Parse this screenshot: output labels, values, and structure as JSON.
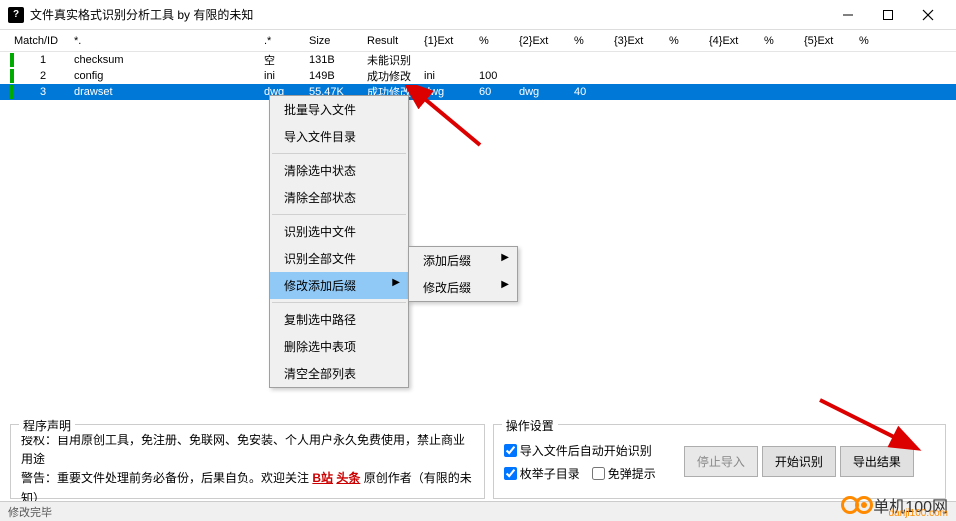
{
  "window": {
    "title": "文件真实格式识别分析工具 by 有限的未知",
    "icon": "?"
  },
  "columns": {
    "match": "Match/ID",
    "star": "*.",
    "dotstar": ".*",
    "size": "Size",
    "result": "Result",
    "e1": "{1}Ext",
    "p1": "%",
    "e2": "{2}Ext",
    "p2": "%",
    "e3": "{3}Ext",
    "p3": "%",
    "e4": "{4}Ext",
    "p4": "%",
    "e5": "{5}Ext",
    "p5": "%"
  },
  "rows": [
    {
      "id": "1",
      "name": "checksum",
      "ds": "空",
      "size": "131B",
      "result": "未能识别",
      "e1": "",
      "p1": "",
      "e2": "",
      "p2": ""
    },
    {
      "id": "2",
      "name": "config",
      "ds": "ini",
      "size": "149B",
      "result": "成功修改",
      "e1": "ini",
      "p1": "100",
      "e2": "",
      "p2": ""
    },
    {
      "id": "3",
      "name": "drawset",
      "ds": "dwg",
      "size": "55.47K",
      "result": "成功修改",
      "e1": "dwg",
      "p1": "60",
      "e2": "dwg",
      "p2": "40"
    }
  ],
  "ctx": {
    "g1a": "批量导入文件",
    "g1b": "导入文件目录",
    "g2a": "清除选中状态",
    "g2b": "清除全部状态",
    "g3a": "识别选中文件",
    "g3b": "识别全部文件",
    "g3c": "修改添加后缀",
    "g4a": "复制选中路径",
    "g4b": "删除选中表项",
    "g4c": "清空全部列表"
  },
  "sub": {
    "a": "添加后缀",
    "b": "修改后缀"
  },
  "decl": {
    "title": "程序声明",
    "l1a": "授权：自用原创工具，免注册、免联网、免安装、个人用户永久免费使用，禁止商业用途",
    "l2a": "警告：重要文件处理前务必备份，后果自负。欢迎关注 ",
    "l2b": "B站",
    "l2c": " ",
    "l2d": "头条",
    "l2e": " 原创作者（有限的未知）"
  },
  "ops": {
    "title": "操作设置",
    "c1": "导入文件后自动开始识别",
    "c2": "枚举子目录",
    "c3": "免弹提示",
    "b1": "停止导入",
    "b2": "开始识别",
    "b3": "导出结果"
  },
  "status": "修改完毕",
  "wm": {
    "text": "单机100网",
    "sub": "danji100.com"
  }
}
